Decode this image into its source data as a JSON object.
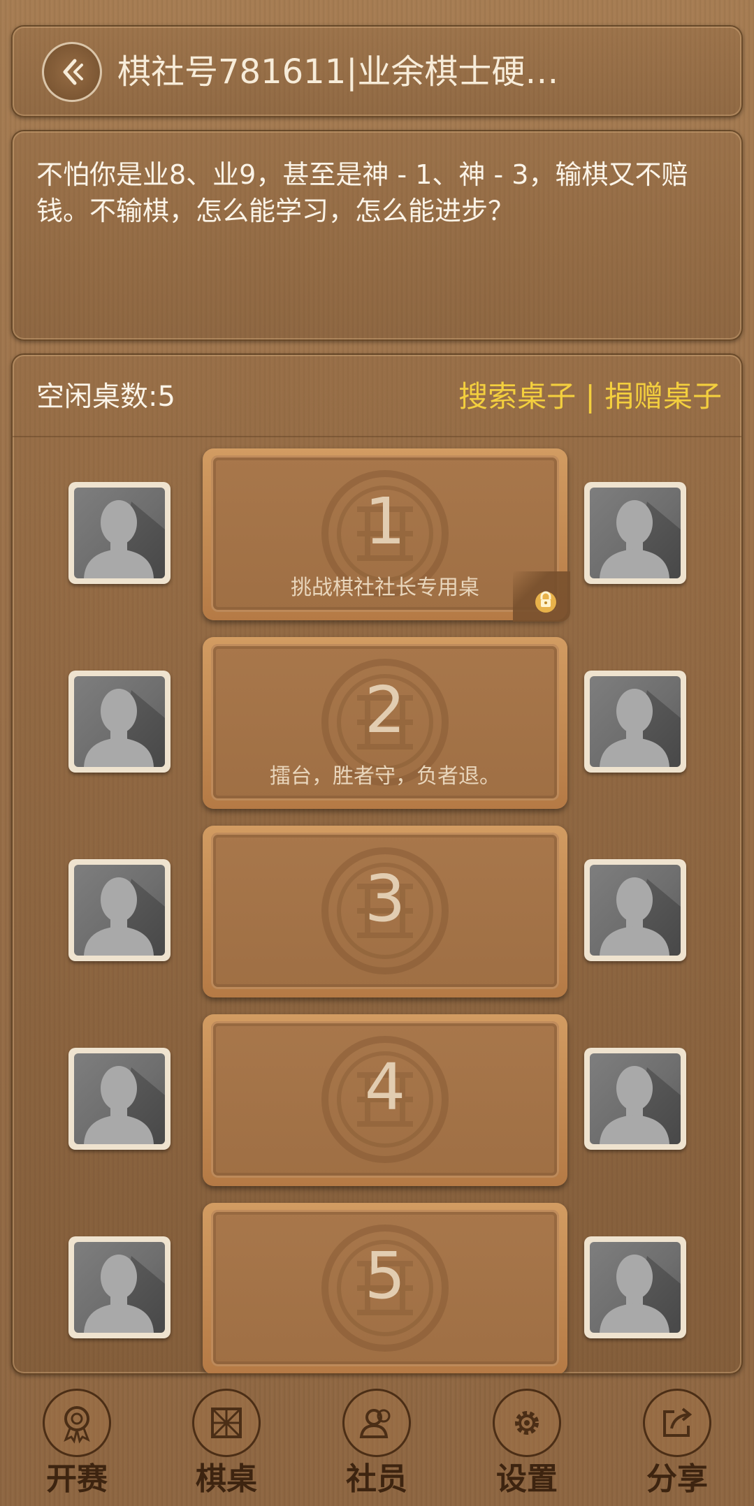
{
  "header": {
    "title": "棋社号781611|业余棋士硬…"
  },
  "notice": {
    "text": "不怕你是业8、业9，甚至是神 - 1、神 - 3，输棋又不赔钱。不输棋，怎么能学习，怎么能进步？"
  },
  "tables_header": {
    "free_count_label": "空闲桌数:5",
    "search_link": "搜索桌子",
    "separator": " | ",
    "donate_link": "捐赠桌子"
  },
  "tables": [
    {
      "number": "1",
      "description": "挑战棋社社长专用桌",
      "locked": true
    },
    {
      "number": "2",
      "description": "擂台，胜者守，负者退。",
      "locked": false
    },
    {
      "number": "3",
      "description": "",
      "locked": false
    },
    {
      "number": "4",
      "description": "",
      "locked": false
    },
    {
      "number": "5",
      "description": "",
      "locked": false
    }
  ],
  "bottom_nav": {
    "items": [
      {
        "label": "开赛",
        "icon": "medal-icon"
      },
      {
        "label": "棋桌",
        "icon": "board-icon"
      },
      {
        "label": "社员",
        "icon": "members-icon"
      },
      {
        "label": "设置",
        "icon": "gear-icon"
      },
      {
        "label": "分享",
        "icon": "share-icon"
      }
    ]
  },
  "colors": {
    "link_yellow": "#f3cf3e",
    "text_light": "#fbf4e8",
    "wood": "#9a7049"
  }
}
